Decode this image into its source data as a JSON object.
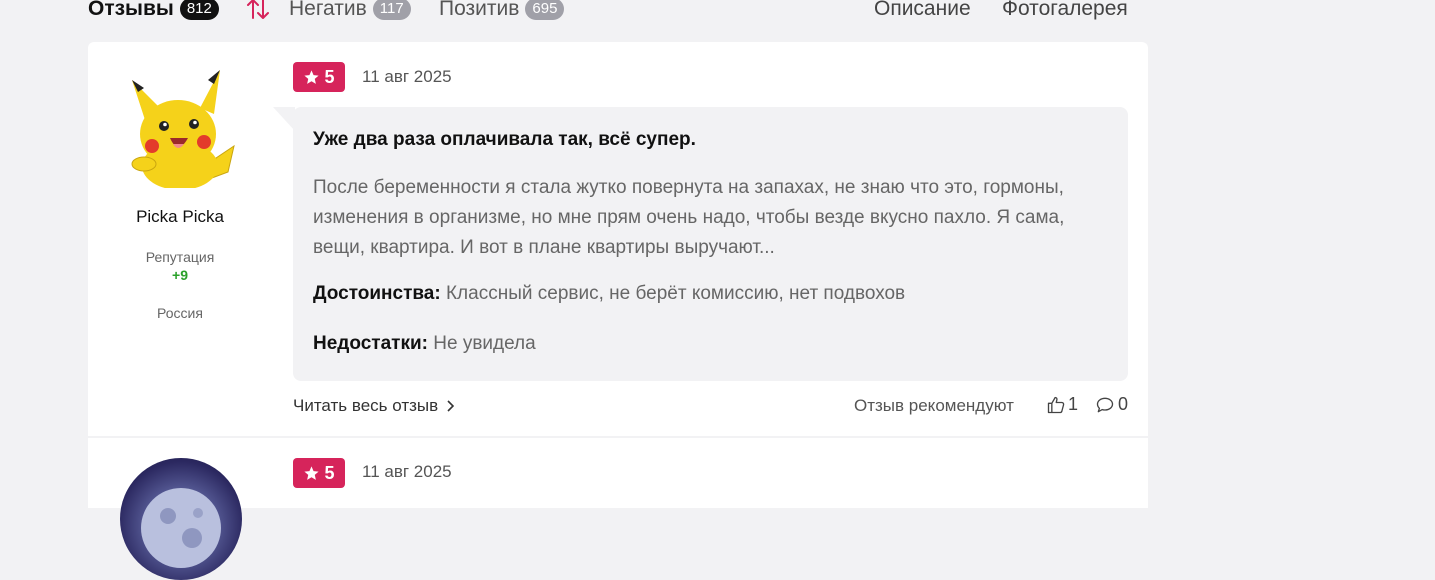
{
  "tabs": {
    "reviews": {
      "label": "Отзывы",
      "count": "812"
    },
    "negative": {
      "label": "Негатив",
      "count": "117"
    },
    "positive": {
      "label": "Позитив",
      "count": "695"
    },
    "description": "Описание",
    "gallery": "Фотогалерея"
  },
  "colors": {
    "accent": "#d6245b",
    "reputation": "#2aa12a"
  },
  "reviews": [
    {
      "author": {
        "name": "Picka Picka",
        "reputation_label": "Репутация",
        "reputation": "+9",
        "country": "Россия",
        "avatar_icon": "pikachu-avatar"
      },
      "rating": "5",
      "date": "11 авг 2025",
      "title": "Уже два раза оплачивала так, всё супер.",
      "body": "После беременности я стала жутко повернута на запахах, не знаю что это, гормоны, изменения в организме, но мне прям очень надо, чтобы везде вкусно пахло. Я сама, вещи, квартира. И вот в плане квартиры выручают...",
      "pros_label": "Достоинства:",
      "pros": "Классный сервис, не берёт комиссию, нет подвохов",
      "cons_label": "Недостатки:",
      "cons": "Не увидела",
      "read_more": "Читать весь отзыв",
      "recommend_label": "Отзыв рекомендуют",
      "likes": "1",
      "comments": "0"
    },
    {
      "rating": "5",
      "date": "11 авг 2025",
      "author": {
        "avatar_icon": "moon-avatar"
      }
    }
  ]
}
